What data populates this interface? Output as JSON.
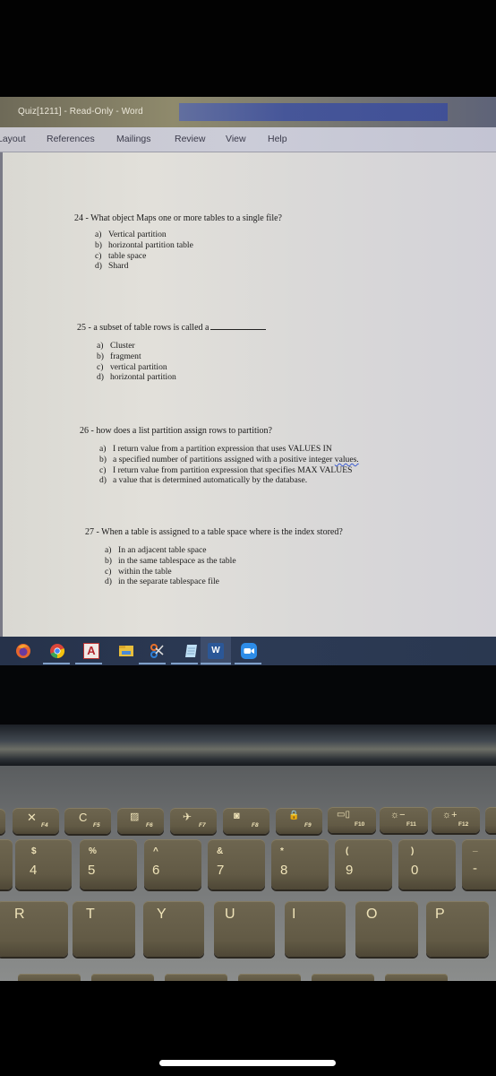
{
  "window": {
    "title": "Quiz[1211]  -  Read-Only  -  Word"
  },
  "ribbon": {
    "tabs": [
      {
        "label": "Layout"
      },
      {
        "label": "References"
      },
      {
        "label": "Mailings"
      },
      {
        "label": "Review"
      },
      {
        "label": "View"
      },
      {
        "label": "Help"
      }
    ]
  },
  "document": {
    "questions": [
      {
        "number": "24",
        "stem": "24 - What object Maps one or more tables to a single file?",
        "options": [
          {
            "letter": "a)",
            "text": "Vertical partition"
          },
          {
            "letter": "b)",
            "text": "horizontal partition table"
          },
          {
            "letter": "c)",
            "text": "table space"
          },
          {
            "letter": "d)",
            "text": "Shard"
          }
        ]
      },
      {
        "number": "25",
        "stem": "25 - a subset of table rows is called a",
        "options": [
          {
            "letter": "a)",
            "text": "Cluster"
          },
          {
            "letter": "b)",
            "text": "fragment"
          },
          {
            "letter": "c)",
            "text": "vertical partition"
          },
          {
            "letter": "d)",
            "text": "horizontal partition"
          }
        ]
      },
      {
        "number": "26",
        "stem": "26 - how does a list partition assign rows to partition?",
        "options": [
          {
            "letter": "a)",
            "text": "I return value from a partition expression that uses VALUES IN"
          },
          {
            "letter": "b)",
            "text": "a specified number of partitions assigned with a positive integer",
            "spellcheck_word": "values."
          },
          {
            "letter": "c)",
            "text": "I return value from partition expression that specifies MAX VALUES"
          },
          {
            "letter": "d)",
            "text": "a value that is determined automatically by the database."
          }
        ]
      },
      {
        "number": "27",
        "stem": "27 - When a table is assigned to a table space where is the index stored?",
        "options": [
          {
            "letter": "a)",
            "text": "In an adjacent table space"
          },
          {
            "letter": "b)",
            "text": "in the same tablespace as the table"
          },
          {
            "letter": "c)",
            "text": "within the table"
          },
          {
            "letter": "d)",
            "text": "in the separate tablespace file"
          }
        ]
      }
    ]
  },
  "taskbar": {
    "apps": [
      {
        "name": "Firefox",
        "icon": "firefox-icon",
        "running": false
      },
      {
        "name": "Chrome",
        "icon": "chrome-icon",
        "running": true
      },
      {
        "name": "Access",
        "icon": "access-icon",
        "label": "A",
        "running": true
      },
      {
        "name": "File Explorer",
        "icon": "folder-icon",
        "running": false
      },
      {
        "name": "Snipping Tool",
        "icon": "snipping-tool-icon",
        "running": true
      },
      {
        "name": "Notepad",
        "icon": "notepad-icon",
        "running": true
      },
      {
        "name": "Word",
        "icon": "word-icon",
        "label": "W",
        "running": true,
        "active": true
      },
      {
        "name": "Zoom",
        "icon": "zoom-icon",
        "running": true
      }
    ]
  },
  "keyboard": {
    "function_row": [
      {
        "fn": "F4",
        "symbol": "✕"
      },
      {
        "fn": "F5",
        "symbol": "C"
      },
      {
        "fn": "F6",
        "symbol": "▨"
      },
      {
        "fn": "F7",
        "symbol": "✈"
      },
      {
        "fn": "F8",
        "symbol": "◙"
      },
      {
        "fn": "F9",
        "symbol": "🔒"
      },
      {
        "fn": "F10",
        "symbol": "▭▯"
      },
      {
        "fn": "F11",
        "symbol": "☼−"
      },
      {
        "fn": "F12",
        "symbol": "☼+"
      }
    ],
    "number_row": [
      {
        "top": "$",
        "main": "4"
      },
      {
        "top": "%",
        "main": "5"
      },
      {
        "top": "^",
        "main": "6"
      },
      {
        "top": "&",
        "main": "7"
      },
      {
        "top": "*",
        "main": "8"
      },
      {
        "top": "(",
        "main": "9"
      },
      {
        "top": ")",
        "main": "0"
      },
      {
        "top": "_",
        "main": "-"
      }
    ],
    "letter_row": [
      "R",
      "T",
      "Y",
      "U",
      "I",
      "O",
      "P"
    ]
  },
  "colors": {
    "word_blue": "#2b5797",
    "taskbar": "#2a3850",
    "key_cap": "#625a45",
    "key_legend": "#efe3b8"
  }
}
